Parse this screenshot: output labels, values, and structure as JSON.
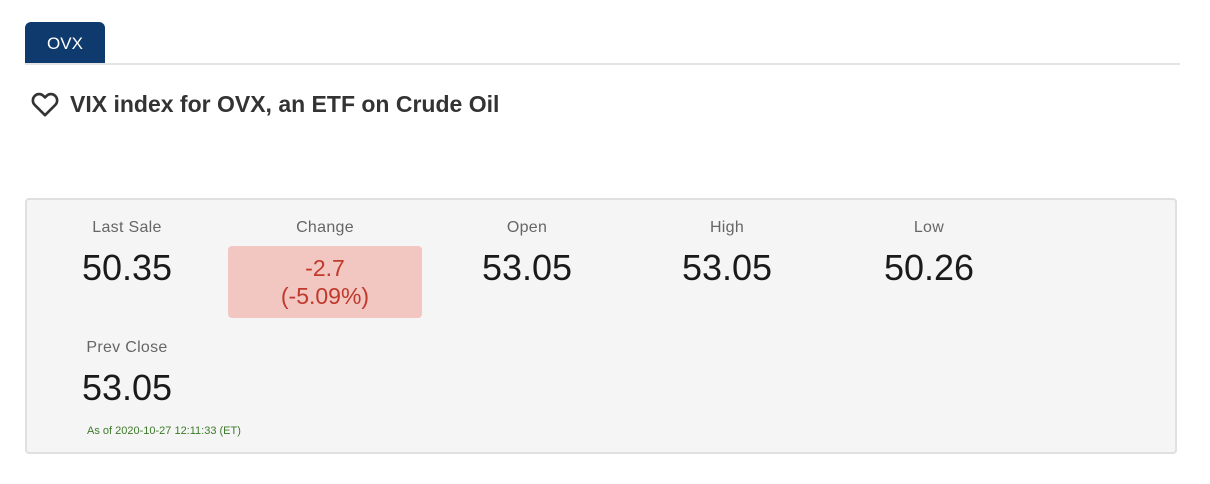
{
  "tab": {
    "label": "OVX"
  },
  "header": {
    "title": "VIX index for OVX, an ETF on Crude Oil",
    "favorite_icon": "heart-outline-icon"
  },
  "quote": {
    "last_sale": {
      "label": "Last Sale",
      "value": "50.35"
    },
    "change": {
      "label": "Change",
      "value": "-2.7",
      "percent": "(-5.09%)"
    },
    "open": {
      "label": "Open",
      "value": "53.05"
    },
    "high": {
      "label": "High",
      "value": "53.05"
    },
    "low": {
      "label": "Low",
      "value": "50.26"
    },
    "prev_close": {
      "label": "Prev Close",
      "value": "53.05"
    },
    "as_of": "As of 2020-10-27 12:11:33 (ET)"
  },
  "colors": {
    "tab_background": "#0f3a6d",
    "negative_text": "#c0392b",
    "negative_background": "#f2c6c1",
    "timestamp_text": "#3d7a2a"
  }
}
